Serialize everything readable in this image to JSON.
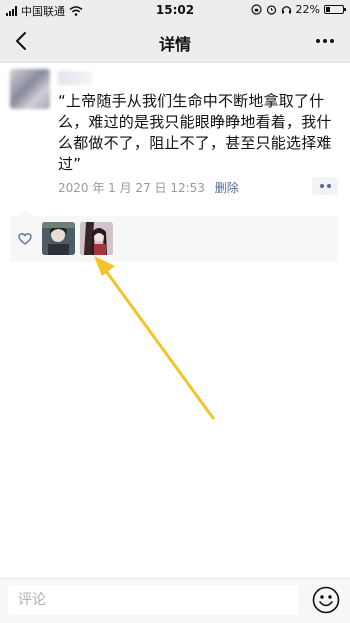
{
  "status_bar": {
    "carrier": "中国联通",
    "time": "15:02",
    "battery": "22%"
  },
  "nav": {
    "title": "详情"
  },
  "post": {
    "content": "“上帝随手从我们生命中不断地拿取了什么，难过的是我只能眼睁睁地看着，我什么都做不了，阻止不了，甚至只能选择难过”",
    "timestamp": "2020 年 1 月 27 日 12:53",
    "delete_label": "删除"
  },
  "comment": {
    "placeholder": "评论"
  },
  "colors": {
    "link": "#576b95",
    "nav_bg": "#ededed",
    "arrow": "#f2c42a"
  },
  "icons": {
    "back": "back-icon",
    "more": "more-icon",
    "heart": "heart-icon",
    "emoji": "emoji-icon",
    "wifi": "wifi-icon",
    "alarm": "alarm-icon",
    "headphones": "headphones-icon",
    "battery": "battery-icon"
  }
}
